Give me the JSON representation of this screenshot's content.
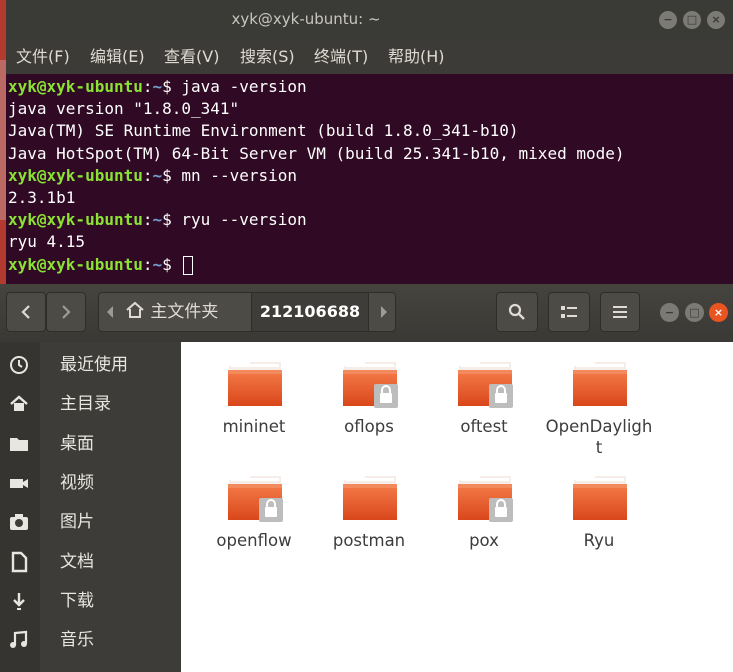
{
  "terminal": {
    "title": "xyk@xyk-ubuntu: ~",
    "menu": [
      "文件(F)",
      "编辑(E)",
      "查看(V)",
      "搜索(S)",
      "终端(T)",
      "帮助(H)"
    ],
    "prompt_user": "xyk@xyk-ubuntu",
    "prompt_sep": ":",
    "prompt_path": "~",
    "prompt_end": "$ ",
    "cmd1": "java -version",
    "out1": "java version \"1.8.0_341\"",
    "out2": "Java(TM) SE Runtime Environment (build 1.8.0_341-b10)",
    "out3": "Java HotSpot(TM) 64-Bit Server VM (build 25.341-b10, mixed mode)",
    "cmd2": "mn --version",
    "out4": "2.3.1b1",
    "cmd3": "ryu --version",
    "out5": "ryu 4.15"
  },
  "files": {
    "path_home": "主文件夹",
    "path_current": "212106688",
    "sidebar": [
      "最近使用",
      "主目录",
      "桌面",
      "视频",
      "图片",
      "文档",
      "下载",
      "音乐"
    ],
    "folders": [
      {
        "name": "mininet",
        "locked": false
      },
      {
        "name": "oflops",
        "locked": true
      },
      {
        "name": "oftest",
        "locked": true
      },
      {
        "name": "OpenDaylight",
        "locked": false
      },
      {
        "name": "openflow",
        "locked": true
      },
      {
        "name": "postman",
        "locked": false
      },
      {
        "name": "pox",
        "locked": true
      },
      {
        "name": "Ryu",
        "locked": false
      }
    ]
  },
  "colors": {
    "terminal_bg": "#300a24",
    "prompt_green": "#8ae234",
    "path_blue": "#729fcf",
    "folder_orange": "#e95420",
    "close_button": "#e95420"
  },
  "icons": {
    "sidebar": [
      "clock-icon",
      "home-icon",
      "folder-icon",
      "video-icon",
      "camera-icon",
      "document-icon",
      "download-icon",
      "music-icon"
    ]
  }
}
